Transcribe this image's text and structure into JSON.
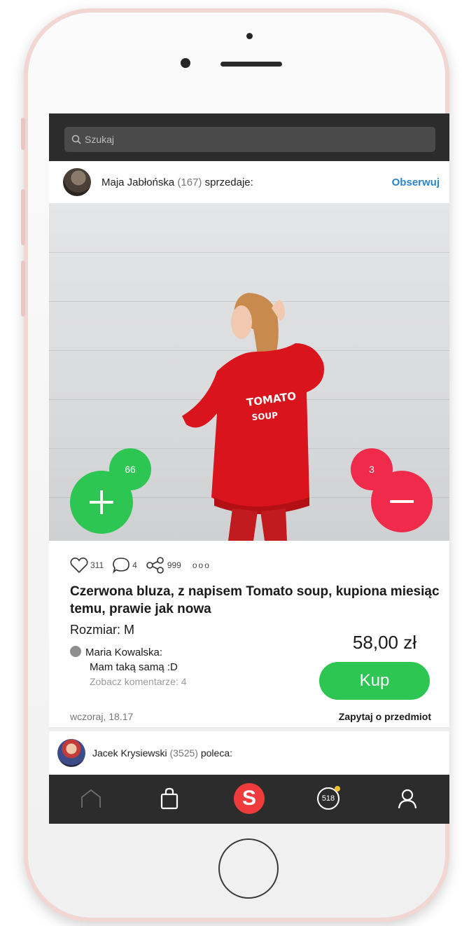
{
  "search": {
    "placeholder": "Szukaj",
    "icon": "search-icon"
  },
  "seller": {
    "name": "Maja Jabłońska",
    "count": "(167)",
    "action": "sprzedaje:",
    "follow_label": "Obserwuj"
  },
  "product": {
    "image_alt": "Woman in red sweatshirt",
    "upvotes": "66",
    "downvotes": "3",
    "likes": "311",
    "comments": "4",
    "shares": "999",
    "more": "ooo",
    "title": "Czerwona bluza, z napisem Tomato soup, kupiona miesiąc temu, prawie jak nowa",
    "size": "Rozmiar: M",
    "price": "58,00 zł",
    "buy_label": "Kup",
    "date": "wczoraj, 18.17",
    "ask_label": "Zapytaj o przedmiot"
  },
  "comment": {
    "author": "Maria Kowalska:",
    "text": "Mam taką samą :D",
    "more": "Zobacz komentarze: 4"
  },
  "recommender": {
    "name": "Jacek Krysiewski",
    "count": "(3525)",
    "action": "poleca:"
  },
  "tabbar": {
    "items": [
      {
        "icon": "home-icon"
      },
      {
        "icon": "shopping-bag-icon"
      },
      {
        "icon": "s-logo-icon",
        "label": "S"
      },
      {
        "icon": "notifications-icon",
        "label": "518"
      },
      {
        "icon": "profile-icon"
      }
    ]
  },
  "colors": {
    "green": "#2dc653",
    "red": "#ef2a4a",
    "link_blue": "#2a85c9",
    "bar_dark": "#2c2c2c"
  }
}
